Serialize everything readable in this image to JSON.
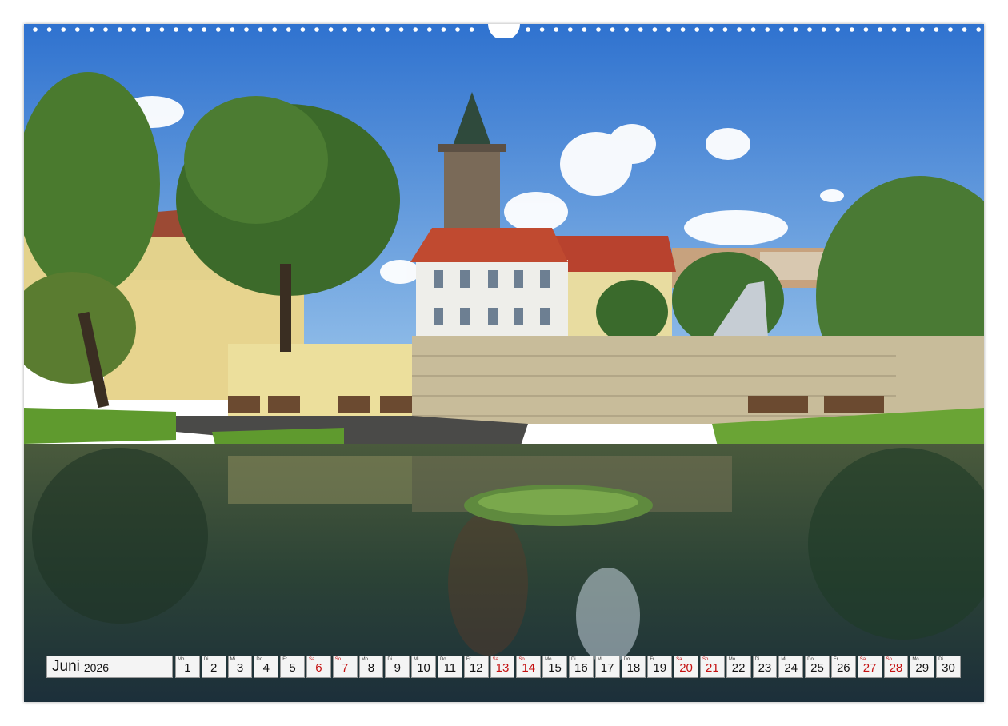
{
  "calendar": {
    "month": "Juni",
    "year": "2026",
    "days": [
      {
        "wd": "Mo",
        "n": "1",
        "weekend": false
      },
      {
        "wd": "Di",
        "n": "2",
        "weekend": false
      },
      {
        "wd": "Mi",
        "n": "3",
        "weekend": false
      },
      {
        "wd": "Do",
        "n": "4",
        "weekend": false
      },
      {
        "wd": "Fr",
        "n": "5",
        "weekend": false
      },
      {
        "wd": "Sa",
        "n": "6",
        "weekend": true
      },
      {
        "wd": "So",
        "n": "7",
        "weekend": true
      },
      {
        "wd": "Mo",
        "n": "8",
        "weekend": false
      },
      {
        "wd": "Di",
        "n": "9",
        "weekend": false
      },
      {
        "wd": "Mi",
        "n": "10",
        "weekend": false
      },
      {
        "wd": "Do",
        "n": "11",
        "weekend": false
      },
      {
        "wd": "Fr",
        "n": "12",
        "weekend": false
      },
      {
        "wd": "Sa",
        "n": "13",
        "weekend": true
      },
      {
        "wd": "So",
        "n": "14",
        "weekend": true
      },
      {
        "wd": "Mo",
        "n": "15",
        "weekend": false
      },
      {
        "wd": "Di",
        "n": "16",
        "weekend": false
      },
      {
        "wd": "Mi",
        "n": "17",
        "weekend": false
      },
      {
        "wd": "Do",
        "n": "18",
        "weekend": false
      },
      {
        "wd": "Fr",
        "n": "19",
        "weekend": false
      },
      {
        "wd": "Sa",
        "n": "20",
        "weekend": true
      },
      {
        "wd": "So",
        "n": "21",
        "weekend": true
      },
      {
        "wd": "Mo",
        "n": "22",
        "weekend": false
      },
      {
        "wd": "Di",
        "n": "23",
        "weekend": false
      },
      {
        "wd": "Mi",
        "n": "24",
        "weekend": false
      },
      {
        "wd": "Do",
        "n": "25",
        "weekend": false
      },
      {
        "wd": "Fr",
        "n": "26",
        "weekend": false
      },
      {
        "wd": "Sa",
        "n": "27",
        "weekend": true
      },
      {
        "wd": "So",
        "n": "28",
        "weekend": true
      },
      {
        "wd": "Mo",
        "n": "29",
        "weekend": false
      },
      {
        "wd": "Di",
        "n": "30",
        "weekend": false
      }
    ]
  },
  "colors": {
    "sky": "#3d7fd1",
    "weekend_red": "#c41010",
    "water": "#2f4a3a",
    "foliage": "#3f6e2a"
  }
}
